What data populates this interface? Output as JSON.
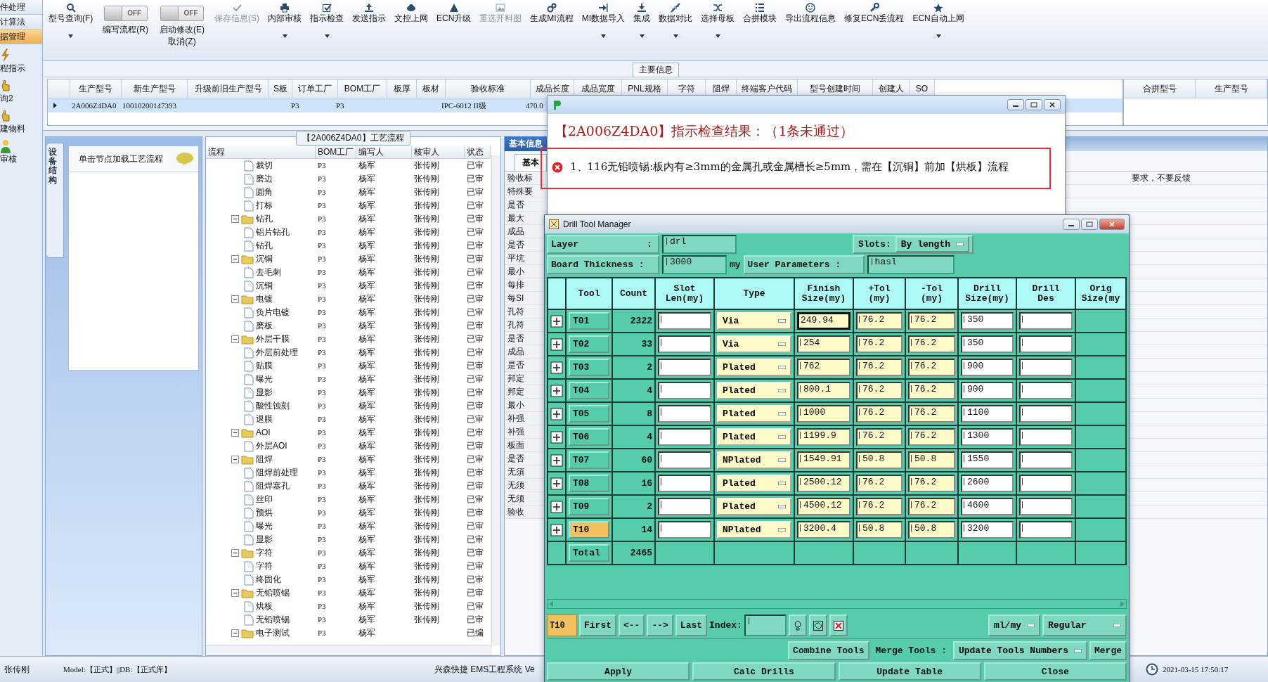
{
  "left_nav": [
    {
      "label": "件处理",
      "kind": "text",
      "selected": false
    },
    {
      "label": "计算法",
      "kind": "text",
      "selected": false
    },
    {
      "label": "据管理",
      "kind": "text",
      "selected": true
    },
    {
      "label": "程指示",
      "kind": "icon",
      "selected": false
    },
    {
      "label": "询2",
      "kind": "icon",
      "selected": false
    },
    {
      "label": "建物料",
      "kind": "icon",
      "selected": false
    },
    {
      "label": "审核",
      "kind": "icon",
      "selected": false
    }
  ],
  "toolbar": [
    {
      "kind": "button",
      "label": "型号查询(F)",
      "dropdown": true,
      "disabled": false
    },
    {
      "kind": "toggle",
      "label": "编写流程(R)",
      "state_text": "OFF",
      "on": false
    },
    {
      "kind": "toggle",
      "label": "启动修改(E)",
      "sublabel": "取消(Z)",
      "state_text": "OFF",
      "on": false
    },
    {
      "kind": "button",
      "label": "保存信息(S)",
      "dropdown": false,
      "disabled": true
    },
    {
      "kind": "button",
      "label": "内部审核",
      "dropdown": true,
      "disabled": false
    },
    {
      "kind": "button",
      "label": "指示检查",
      "dropdown": true,
      "disabled": false
    },
    {
      "kind": "button",
      "label": "发送指示",
      "dropdown": false,
      "disabled": false
    },
    {
      "kind": "button",
      "label": "文控上网",
      "dropdown": false,
      "disabled": false
    },
    {
      "kind": "button",
      "label": "ECN升级",
      "dropdown": false,
      "disabled": false
    },
    {
      "kind": "button",
      "label": "重选开料图",
      "dropdown": false,
      "disabled": true
    },
    {
      "kind": "button",
      "label": "生成MI流程",
      "dropdown": false,
      "disabled": false
    },
    {
      "kind": "button",
      "label": "MI数据导入",
      "dropdown": true,
      "disabled": false
    },
    {
      "kind": "button",
      "label": "集成",
      "dropdown": true,
      "disabled": false
    },
    {
      "kind": "button",
      "label": "数据对比",
      "dropdown": true,
      "disabled": false
    },
    {
      "kind": "button",
      "label": "选择母板",
      "dropdown": true,
      "disabled": false
    },
    {
      "kind": "button",
      "label": "合拼模块",
      "dropdown": false,
      "disabled": false
    },
    {
      "kind": "button",
      "label": "导出流程信息",
      "dropdown": false,
      "disabled": false
    },
    {
      "kind": "button",
      "label": "修复ECN丢流程",
      "dropdown": false,
      "disabled": false
    },
    {
      "kind": "button",
      "label": "ECN自动上网",
      "dropdown": true,
      "disabled": false
    }
  ],
  "main_info": {
    "title": "主要信息",
    "columns": [
      "生产型号",
      "新生产型号",
      "升级前旧生产型号",
      "S板",
      "订单工厂",
      "BOM工厂",
      "板厚",
      "板材",
      "验收标准",
      "成品长度",
      "成品宽度",
      "PNL规格",
      "字符",
      "阻焊",
      "终端客户代码",
      "型号创建时间",
      "创建人",
      "SO"
    ],
    "rows": [
      {
        "selected": true,
        "cells": [
          "2A006Z4DA0",
          "10010200147393",
          null,
          null,
          "P3",
          "P3",
          null,
          null,
          "IPC-6012 II级",
          "470.0"
        ]
      }
    ],
    "side_columns": [
      "合拼型号",
      "生产型号"
    ]
  },
  "structure_panel": {
    "tab": "设备结构",
    "hint": "单击节点加载工艺流程"
  },
  "process_tree": {
    "title": "【2A006Z4DA0】工艺流程",
    "columns": [
      "流程",
      "BOM工厂",
      "编写人",
      "核审人",
      "状态"
    ],
    "nodes": [
      {
        "expanded": true,
        "children": [
          {
            "name": "裁切",
            "bom": "P3",
            "writer": "杨军",
            "reviewer": "张传刚",
            "status": "已审"
          },
          {
            "name": "磨边",
            "bom": "P3",
            "writer": "杨军",
            "reviewer": "张传刚",
            "status": "已审"
          },
          {
            "name": "圆角",
            "bom": "P3",
            "writer": "杨军",
            "reviewer": "张传刚",
            "status": "已审"
          },
          {
            "name": "打标",
            "bom": "P3",
            "writer": "杨军",
            "reviewer": "张传刚",
            "status": "已审"
          }
        ]
      },
      {
        "name": "钻孔",
        "bom": "P3",
        "writer": "杨军",
        "reviewer": "张传刚",
        "status": "已审",
        "expanded": true,
        "children": [
          {
            "name": "铝片钻孔",
            "bom": "P3",
            "writer": "杨军",
            "reviewer": "张传刚",
            "status": "已审"
          },
          {
            "name": "钻孔",
            "bom": "P3",
            "writer": "杨军",
            "reviewer": "张传刚",
            "status": "已审"
          }
        ]
      },
      {
        "name": "沉铜",
        "bom": "P3",
        "writer": "杨军",
        "reviewer": "张传刚",
        "status": "已审",
        "expanded": true,
        "children": [
          {
            "name": "去毛刺",
            "bom": "P3",
            "writer": "杨军",
            "reviewer": "张传刚",
            "status": "已审"
          },
          {
            "name": "沉铜",
            "bom": "P3",
            "writer": "杨军",
            "reviewer": "张传刚",
            "status": "已审"
          }
        ]
      },
      {
        "name": "电镀",
        "bom": "P3",
        "writer": "杨军",
        "reviewer": "张传刚",
        "status": "已审",
        "expanded": true,
        "children": [
          {
            "name": "负片电镀",
            "bom": "P3",
            "writer": "杨军",
            "reviewer": "张传刚",
            "status": "已审"
          },
          {
            "name": "磨板",
            "bom": "P3",
            "writer": "杨军",
            "reviewer": "张传刚",
            "status": "已审"
          }
        ]
      },
      {
        "name": "外层干膜",
        "bom": "P3",
        "writer": "杨军",
        "reviewer": "张传刚",
        "status": "已审",
        "expanded": true,
        "children": [
          {
            "name": "外层前处理",
            "bom": "P3",
            "writer": "杨军",
            "reviewer": "张传刚",
            "status": "已审"
          },
          {
            "name": "贴膜",
            "bom": "P3",
            "writer": "杨军",
            "reviewer": "张传刚",
            "status": "已审"
          },
          {
            "name": "曝光",
            "bom": "P3",
            "writer": "杨军",
            "reviewer": "张传刚",
            "status": "已审"
          },
          {
            "name": "显影",
            "bom": "P3",
            "writer": "杨军",
            "reviewer": "张传刚",
            "status": "已审"
          },
          {
            "name": "酸性蚀刻",
            "bom": "P3",
            "writer": "杨军",
            "reviewer": "张传刚",
            "status": "已审"
          },
          {
            "name": "退膜",
            "bom": "P3",
            "writer": "杨军",
            "reviewer": "张传刚",
            "status": "已审"
          }
        ]
      },
      {
        "name": "AOI",
        "bom": "P3",
        "writer": "杨军",
        "reviewer": "张传刚",
        "status": "已审",
        "expanded": true,
        "children": [
          {
            "name": "外层AOI",
            "bom": "P3",
            "writer": "杨军",
            "reviewer": "张传刚",
            "status": "已审"
          }
        ]
      },
      {
        "name": "阻焊",
        "bom": "P3",
        "writer": "杨军",
        "reviewer": "张传刚",
        "status": "已审",
        "expanded": true,
        "children": [
          {
            "name": "阻焊前处理",
            "bom": "P3",
            "writer": "杨军",
            "reviewer": "张传刚",
            "status": "已审"
          },
          {
            "name": "阻焊塞孔",
            "bom": "P3",
            "writer": "杨军",
            "reviewer": "张传刚",
            "status": "已审"
          },
          {
            "name": "丝印",
            "bom": "P3",
            "writer": "杨军",
            "reviewer": "张传刚",
            "status": "已审"
          },
          {
            "name": "预烘",
            "bom": "P3",
            "writer": "杨军",
            "reviewer": "张传刚",
            "status": "已审"
          },
          {
            "name": "曝光",
            "bom": "P3",
            "writer": "杨军",
            "reviewer": "张传刚",
            "status": "已审"
          },
          {
            "name": "显影",
            "bom": "P3",
            "writer": "杨军",
            "reviewer": "张传刚",
            "status": "已审"
          }
        ]
      },
      {
        "name": "字符",
        "bom": "P3",
        "writer": "杨军",
        "reviewer": "张传刚",
        "status": "已审",
        "expanded": true,
        "children": [
          {
            "name": "字符",
            "bom": "P3",
            "writer": "杨军",
            "reviewer": "张传刚",
            "status": "已审"
          },
          {
            "name": "终固化",
            "bom": "P3",
            "writer": "杨军",
            "reviewer": "张传刚",
            "status": "已审"
          }
        ]
      },
      {
        "name": "无铅喷锡",
        "bom": "P3",
        "writer": "杨军",
        "reviewer": "张传刚",
        "status": "已审",
        "expanded": true,
        "children": [
          {
            "name": "烘板",
            "bom": "P3",
            "writer": "杨军",
            "reviewer": "张传刚",
            "status": "已审"
          },
          {
            "name": "无铅喷锡",
            "bom": "P3",
            "writer": "杨军",
            "reviewer": "张传刚",
            "status": "已审"
          }
        ]
      },
      {
        "name": "电子测试",
        "bom": "P3",
        "writer": "杨军",
        "status": "已编",
        "expanded": true
      }
    ]
  },
  "basic_info": {
    "tab": "基本信息",
    "subtab": "基本",
    "labels": [
      "验收标",
      "特殊要",
      "是否",
      "最大",
      "成品",
      "是否",
      "平坑",
      "最小",
      "每排",
      "每SI",
      "孔符",
      "孔符",
      "是否",
      "成品",
      "是否",
      "邦定",
      "邦定",
      "最小",
      "补强",
      "补强",
      "板面",
      "是否",
      "无須",
      "无须",
      "无须",
      "验收"
    ],
    "first_value": "要求，不要反馈"
  },
  "check_dialog": {
    "heading": "【2A006Z4DA0】指示检查结果：（1条未通过）",
    "messages": [
      {
        "kind": "error",
        "text": "1、116无铅喷锡:板内有≥3mm的金属孔或金属槽长≥5mm，需在【沉铜】前加【烘板】流程"
      }
    ]
  },
  "drill_tool_manager": {
    "title": "Drill Tool Manager",
    "layer_label": "Layer",
    "layer_colon": ":",
    "layer": "drl",
    "slots_label": "Slots:",
    "slots": "By length",
    "thickness_label": "Board Thickness :",
    "thickness": "3000",
    "thickness_unit": "my",
    "user_params_label": "User Parameters :",
    "user_params": "hasl",
    "columns": [
      [
        "Tool"
      ],
      [
        "Count"
      ],
      [
        "Slot",
        "Len(my)"
      ],
      [
        "Type"
      ],
      [
        "Finish",
        "Size(my)"
      ],
      [
        "+Tol",
        "(my)"
      ],
      [
        "-Tol",
        "(my)"
      ],
      [
        "Drill",
        "Size(my)"
      ],
      [
        "Drill",
        "Des"
      ],
      [
        "Orig",
        "Size(my"
      ]
    ],
    "rows": [
      {
        "tool": "T01",
        "count": "2322",
        "type": "Via",
        "finish": "249.94",
        "plus_tol": "76.2",
        "minus_tol": "76.2",
        "drill_size": "350",
        "selected": false,
        "focused": true
      },
      {
        "tool": "T02",
        "count": "33",
        "type": "Via",
        "finish": "254",
        "plus_tol": "76.2",
        "minus_tol": "76.2",
        "drill_size": "350",
        "selected": false,
        "focused": false
      },
      {
        "tool": "T03",
        "count": "2",
        "type": "Plated",
        "finish": "762",
        "plus_tol": "76.2",
        "minus_tol": "76.2",
        "drill_size": "900",
        "selected": false,
        "focused": false
      },
      {
        "tool": "T04",
        "count": "4",
        "type": "Plated",
        "finish": "800.1",
        "plus_tol": "76.2",
        "minus_tol": "76.2",
        "drill_size": "900",
        "selected": false,
        "focused": false
      },
      {
        "tool": "T05",
        "count": "8",
        "type": "Plated",
        "finish": "1000",
        "plus_tol": "76.2",
        "minus_tol": "76.2",
        "drill_size": "1100",
        "selected": false,
        "focused": false
      },
      {
        "tool": "T06",
        "count": "4",
        "type": "Plated",
        "finish": "1199.9",
        "plus_tol": "76.2",
        "minus_tol": "76.2",
        "drill_size": "1300",
        "selected": false,
        "focused": false
      },
      {
        "tool": "T07",
        "count": "60",
        "type": "NPlated",
        "finish": "1549.91",
        "plus_tol": "50.8",
        "minus_tol": "50.8",
        "drill_size": "1550",
        "selected": false,
        "focused": false
      },
      {
        "tool": "T08",
        "count": "16",
        "type": "Plated",
        "finish": "2500.12",
        "plus_tol": "76.2",
        "minus_tol": "76.2",
        "drill_size": "2600",
        "selected": false,
        "focused": false
      },
      {
        "tool": "T09",
        "count": "2",
        "type": "Plated",
        "finish": "4500.12",
        "plus_tol": "76.2",
        "minus_tol": "76.2",
        "drill_size": "4600",
        "selected": false,
        "focused": false
      },
      {
        "tool": "T10",
        "count": "14",
        "type": "NPlated",
        "finish": "3200.4",
        "plus_tol": "50.8",
        "minus_tol": "50.8",
        "drill_size": "3200",
        "selected": true,
        "focused": false
      }
    ],
    "total_label": "Total",
    "total_count": "2465",
    "current_tool": "T10",
    "nav": [
      "First",
      "<--",
      "-->",
      "Last"
    ],
    "index_label": "Index:",
    "units": "ml/my",
    "mode": "Regular",
    "combine": "Combine Tools",
    "merge_label": "Merge Tools :",
    "update_numbers": "Update Tools Numbers",
    "merge": "Merge",
    "actions": [
      "Apply",
      "Calc Drills",
      "Update Table",
      "Close"
    ]
  },
  "status_bar": {
    "user": "张传刚",
    "model": "Model:【正式】||DB:【正式库】",
    "system": "兴森快捷 EMS工程系统 Ve",
    "datetime": "2021-03-15 17:50:17"
  }
}
